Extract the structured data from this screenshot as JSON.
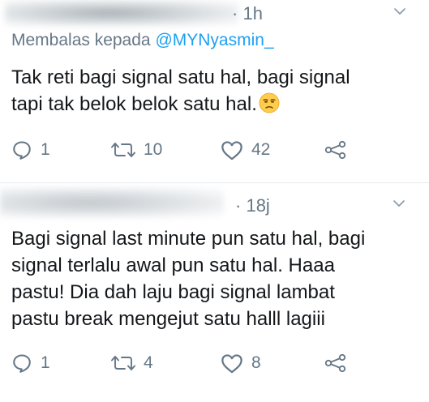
{
  "tweets": [
    {
      "timestamp": "1h",
      "separator": "·",
      "reply_prefix": "Membalas kepada",
      "reply_handle": "@MYNyasmin_",
      "lines": [
        "Tak reti bagi signal satu hal, bagi signal",
        "tapi tak belok belok satu hal."
      ],
      "emoji": "unamused-face",
      "counts": {
        "replies": "1",
        "retweets": "10",
        "likes": "42"
      }
    },
    {
      "timestamp": "18j",
      "separator": "·",
      "lines": [
        "Bagi signal last minute pun satu hal, bagi",
        "signal terlalu awal pun satu hal. Haaa",
        "pastu! Dia dah laju bagi signal lambat",
        "pastu break mengejut satu halll lagiii"
      ],
      "counts": {
        "replies": "1",
        "retweets": "4",
        "likes": "8"
      }
    }
  ],
  "colors": {
    "secondary_text": "#657786",
    "link": "#1da1f2",
    "icon": "#657786",
    "divider": "#e6ecf0",
    "emoji_face": "#ffcc4d"
  },
  "icons": [
    "reply-icon",
    "retweet-icon",
    "like-icon",
    "share-icon",
    "chevron-down-icon"
  ]
}
